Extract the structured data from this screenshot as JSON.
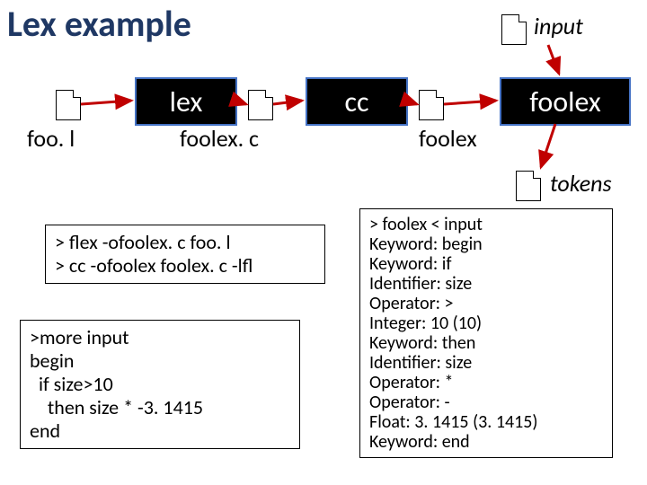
{
  "title": "Lex example",
  "stages": {
    "lex": "lex",
    "cc": "cc",
    "foolex": "foolex"
  },
  "file_labels": {
    "foo_l": "foo. l",
    "foolex_c": "foolex. c",
    "foolex_bin": "foolex",
    "input": "input",
    "tokens": "tokens"
  },
  "shell_box": "> flex -ofoolex. c foo. l\n> cc -ofoolex foolex. c -lfl",
  "input_box": ">more input\nbegin\n  if size>10\n    then size * -3. 1415\nend",
  "output_box": "> foolex < input\nKeyword: begin\nKeyword: if\nIdentifier: size\nOperator: >\nInteger: 10 (10)\nKeyword: then\nIdentifier: size\nOperator: *\nOperator: -\nFloat: 3. 1415 (3. 1415)\nKeyword: end"
}
